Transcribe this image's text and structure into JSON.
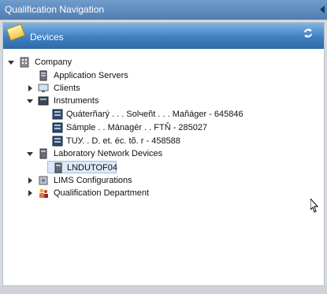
{
  "window": {
    "title": "Qualification Navigation"
  },
  "panel": {
    "title": "Devices"
  },
  "tree": {
    "company": "Company",
    "application_servers": "Application Servers",
    "clients": "Clients",
    "instruments": "Instruments",
    "instrument_items": [
      "Quáterñarý . . . Solчeñt . . . Mañáger - 645846",
      "Sámple . . Mánagér . . FTŇ - 285027",
      "TUУ. . D. et. éc. tõ. r - 458588"
    ],
    "laboratory_network_devices": "Laboratory Network Devices",
    "lnd_selected": "LNDUTOF04",
    "lims_configurations": "LIMS Configurations",
    "qualification_department": "Qualification Department"
  },
  "colors": {
    "accent": "#3f7fc1",
    "titlebar": "#5a88bd"
  }
}
